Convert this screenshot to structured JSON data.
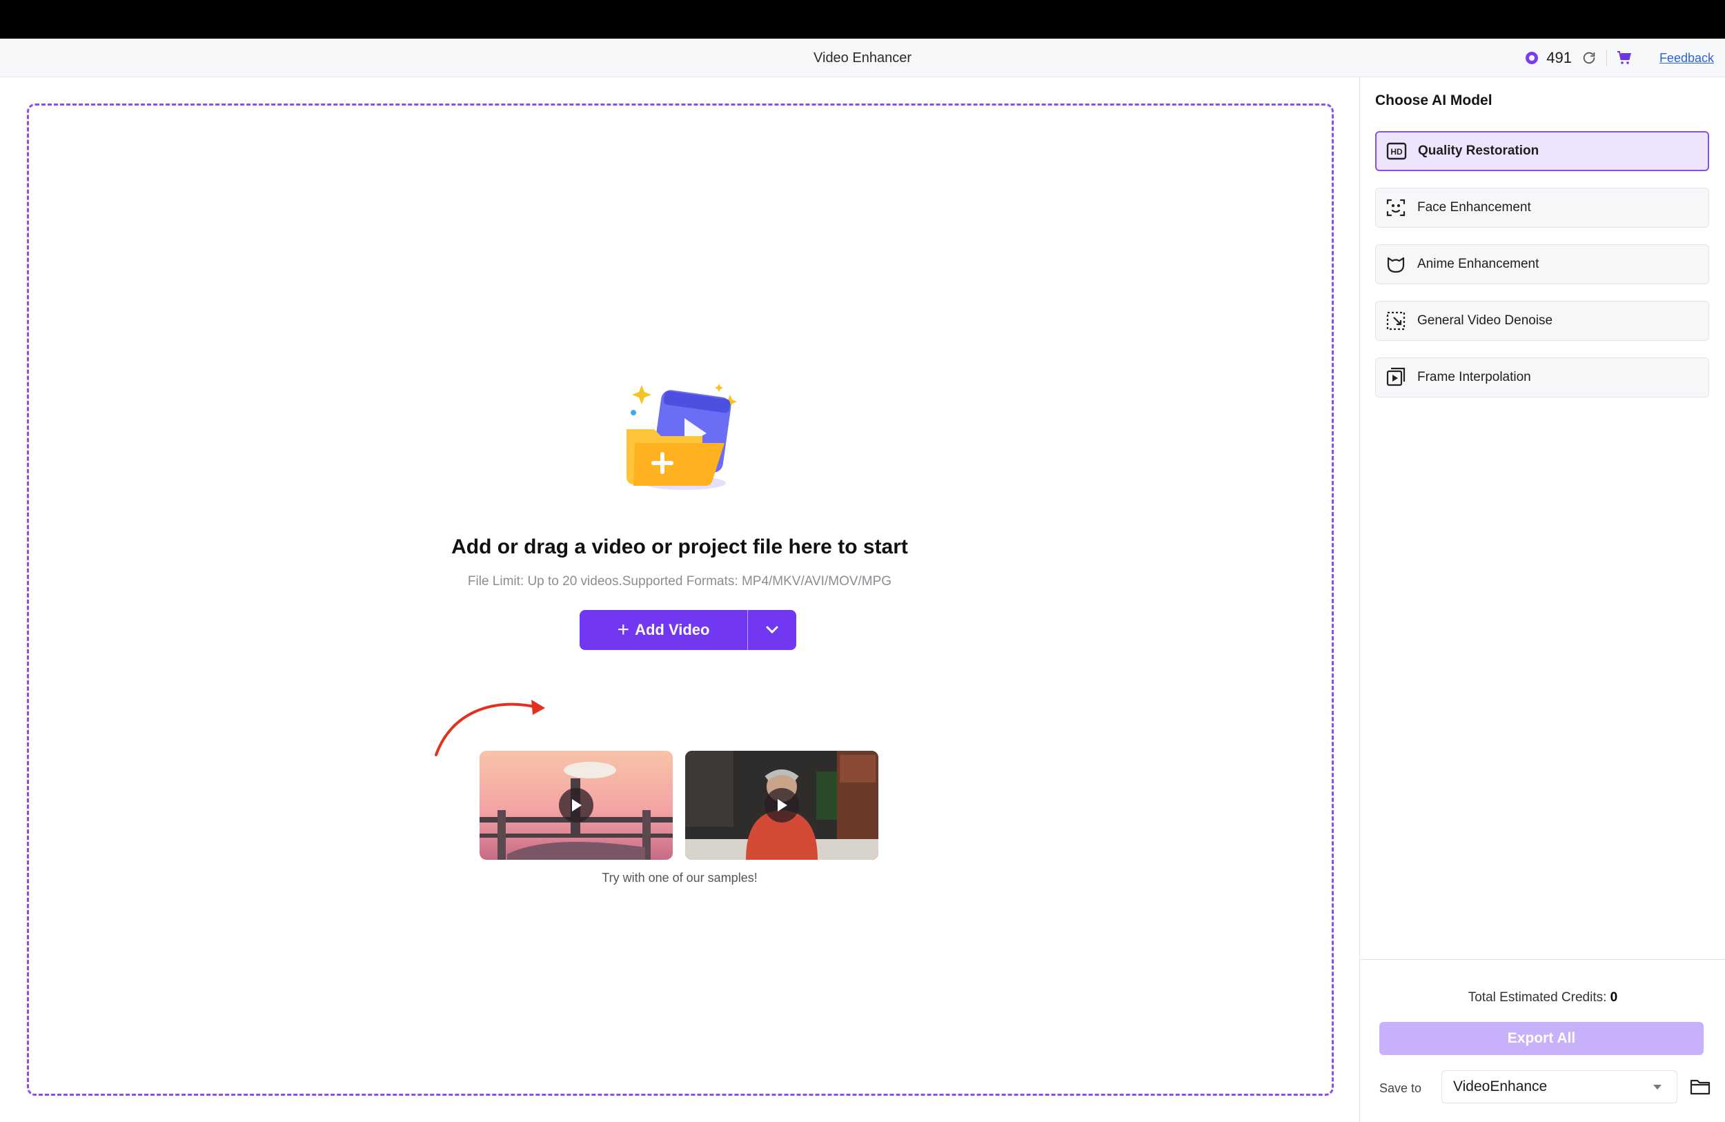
{
  "app": {
    "title": "Video Enhancer",
    "credits": "491",
    "feedback_label": "Feedback",
    "icons": [
      "credit-coin-icon",
      "refresh-icon",
      "cart-icon"
    ]
  },
  "dropzone": {
    "heading": "Add or drag a video or project file here to start",
    "subtext": "File Limit: Up to 20 videos.Supported Formats: MP4/MKV/AVI/MOV/MPG",
    "add_button_label": "Add Video",
    "samples_caption": "Try with one of our samples!"
  },
  "panel": {
    "title": "Choose AI Model",
    "models": [
      {
        "label": "Quality Restoration",
        "icon": "hd-icon",
        "active": true
      },
      {
        "label": "Face Enhancement",
        "icon": "face-scan-icon",
        "active": false
      },
      {
        "label": "Anime Enhancement",
        "icon": "anime-icon",
        "active": false
      },
      {
        "label": "General Video Denoise",
        "icon": "denoise-icon",
        "active": false
      },
      {
        "label": "Frame Interpolation",
        "icon": "frame-interpolation-icon",
        "active": false
      }
    ],
    "hd_badge": "HD",
    "credits_label": "Total Estimated Credits:",
    "credits_value": "0",
    "export_label": "Export All",
    "save_label": "Save to",
    "save_value": "VideoEnhance"
  },
  "colors": {
    "accent": "#7237f0",
    "accent_light": "#eee5fd",
    "export_disabled": "#c8b0fa",
    "dash_border": "#8a4df0"
  }
}
